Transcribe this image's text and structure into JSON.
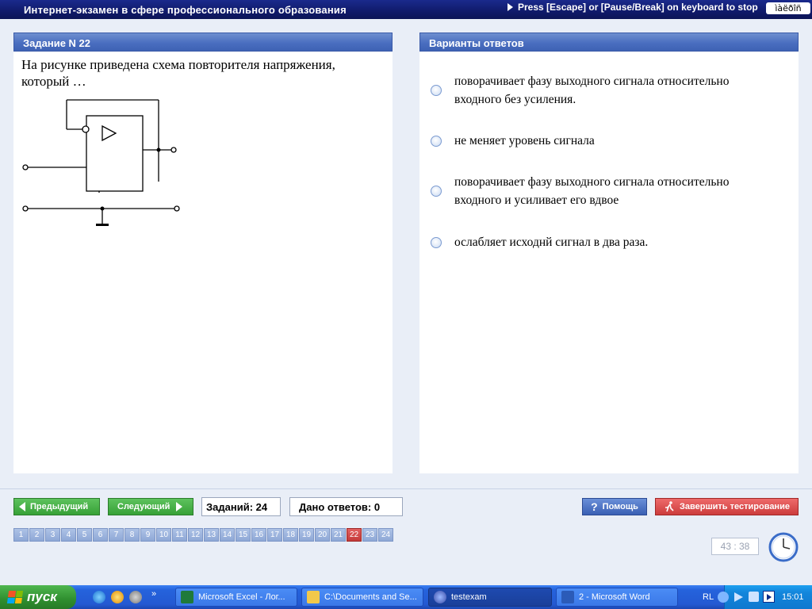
{
  "window": {
    "title": "Интернет-экзамен в сфере профессионального образования",
    "stop_hint": "Press [Escape] or [Pause/Break] on keyboard to stop",
    "lang_box": "ìàëðîñ"
  },
  "question": {
    "header": "Задание N 22",
    "text": "На рисунке приведена схема повторителя напряжения, который …"
  },
  "answers": {
    "header": "Варианты ответов",
    "options": [
      "поворачивает фазу выходного сигнала относительно входного без усиления.",
      "не меняет уровень сигнала",
      "поворачивает фазу выходного сигнала относительно входного и усиливает его вдвое",
      "ослабляет исходнй сигнал в два раза."
    ]
  },
  "nav": {
    "prev_label": "Предыдущий",
    "next_label": "Следующий",
    "tasks_count": "Заданий: 24",
    "answers_given": "Дано ответов: 0",
    "help_label": "Помощь",
    "finish_label": "Завершить тестирование",
    "pages": [
      "1",
      "2",
      "3",
      "4",
      "5",
      "6",
      "7",
      "8",
      "9",
      "10",
      "11",
      "12",
      "13",
      "14",
      "15",
      "16",
      "17",
      "18",
      "19",
      "20",
      "21",
      "22",
      "23",
      "24"
    ],
    "current_page": "22",
    "timer": "43 : 38"
  },
  "taskbar": {
    "start_label": "пуск",
    "tasks": [
      {
        "label": "Microsoft Excel - Лог...",
        "icon": "excel-icon"
      },
      {
        "label": "C:\\Documents and Se...",
        "icon": "folder-icon"
      },
      {
        "label": "testexam",
        "icon": "app-icon"
      },
      {
        "label": "2 - Microsoft Word",
        "icon": "word-icon"
      }
    ],
    "lang": "RL",
    "time": "15:01"
  },
  "colors": {
    "title_bar": "#101a6a",
    "panel_header": "#4a6ec0",
    "active_page": "#c43a3a",
    "nav_button": "#37a137",
    "finish_button": "#cc3c3c"
  }
}
